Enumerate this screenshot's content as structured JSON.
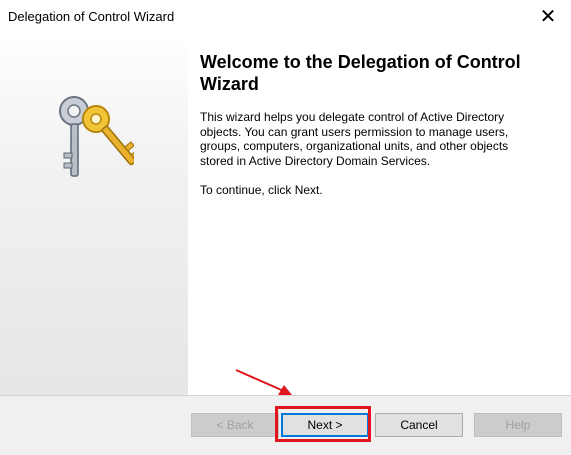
{
  "window": {
    "title": "Delegation of Control Wizard",
    "close_glyph": "✕"
  },
  "content": {
    "heading": "Welcome to the Delegation of Control Wizard",
    "paragraph": "This wizard helps you delegate control of Active Directory objects. You can grant users permission to manage users, groups, computers, organizational units, and other objects stored in Active Directory Domain Services.",
    "instruction": "To continue, click Next."
  },
  "buttons": {
    "back": "< Back",
    "next": "Next >",
    "cancel": "Cancel",
    "help": "Help"
  },
  "icons": {
    "wizard_image": "keys-icon",
    "annotation": "red-arrow-icon"
  },
  "colors": {
    "annotation_red": "#e0161e",
    "focus_blue": "#0078d7",
    "footer_bg": "#f0f0f0"
  }
}
